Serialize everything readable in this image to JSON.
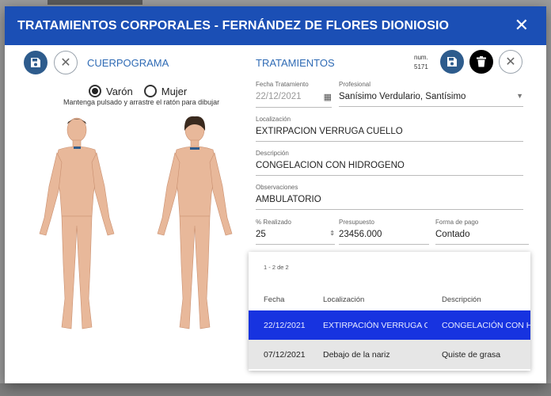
{
  "dialog": {
    "title": "TRATAMIENTOS CORPORALES - FERNÁNDEZ DE FLORES DIONIOSIO",
    "close_icon": "close-icon"
  },
  "left": {
    "section_label": "CUERPOGRAMA",
    "gender_options": [
      "Varón",
      "Mujer"
    ],
    "gender_selected": "Varón",
    "hint": "Mantenga pulsado y arrastre el ratón para dibujar"
  },
  "right": {
    "section_label": "TRATAMIENTOS",
    "num_label": "num.",
    "num_value": "5171"
  },
  "form": {
    "fecha": {
      "label": "Fecha Tratamiento",
      "value": "22/12/2021"
    },
    "profesional": {
      "label": "Profesional",
      "value": "Sanísimo Verdulario, Santísimo"
    },
    "localizacion": {
      "label": "Localización",
      "value": "EXTIRPACIÓN VERRUGA CUELLO"
    },
    "descripcion": {
      "label": "Descripción",
      "value": "CONGELACIÓN CON HIDRÓGENO"
    },
    "observaciones": {
      "label": "Observaciones",
      "value": "AMBULATORIO"
    },
    "realizado": {
      "label": "% Realizado",
      "value": "25"
    },
    "presupuesto": {
      "label": "Presupuesto",
      "value": "23456.000"
    },
    "forma_pago": {
      "label": "Forma de pago",
      "value": "Contado"
    }
  },
  "table": {
    "pager": "1 - 2 de 2",
    "columns": [
      "Fecha",
      "Localización",
      "Descripción"
    ],
    "rows": [
      [
        "22/12/2021",
        "EXTIRPACIÓN VERRUGA CUELLO",
        "CONGELACIÓN CON HIDRÓGENO"
      ],
      [
        "07/12/2021",
        "Debajo de la nariz",
        "Quiste de grasa"
      ]
    ]
  },
  "colors": {
    "header_bg": "#1b4fb5",
    "accent_text": "#2f6bb5",
    "selected_row": "#1733e0"
  }
}
